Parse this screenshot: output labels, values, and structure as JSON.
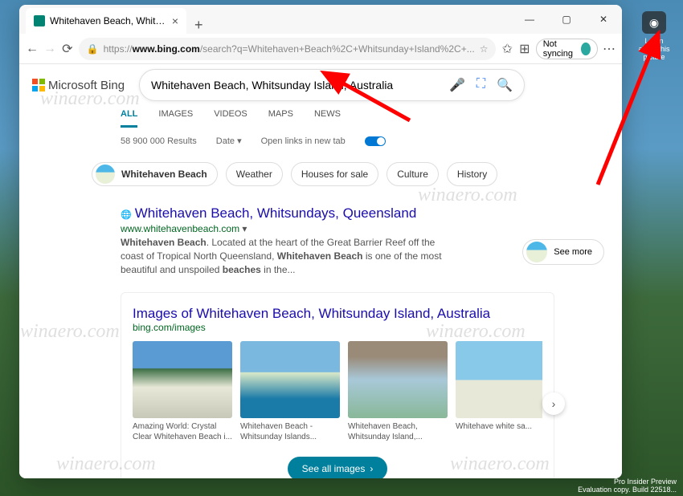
{
  "browser": {
    "tab_title": "Whitehaven Beach, Whitsunday",
    "nav": {
      "url_proto": "https://",
      "url_host": "www.bing.com",
      "url_path": "/search?q=Whitehaven+Beach%2C+Whitsunday+Island%2C+...",
      "sync_label": "Not syncing"
    }
  },
  "desktop_icon": {
    "label": "Learn about this picture"
  },
  "bing": {
    "logo": "Microsoft Bing",
    "search_value": "Whitehaven Beach, Whitsunday Island, Australia",
    "tabs": [
      "ALL",
      "IMAGES",
      "VIDEOS",
      "MAPS",
      "NEWS"
    ],
    "results_count": "58 900 000 Results",
    "date_label": "Date",
    "newtab_label": "Open links in new tab",
    "entity": {
      "name": "Whitehaven Beach",
      "chips": [
        "Weather",
        "Houses for sale",
        "Culture",
        "History"
      ]
    },
    "see_more": "See more",
    "result1": {
      "title": "Whitehaven Beach, Whitsundays, Queensland",
      "url": "www.whitehavenbeach.com",
      "desc_a": "Whitehaven Beach",
      "desc_b": ". Located at the heart of the Great Barrier Reef off the coast of Tropical North Queensland, ",
      "desc_c": "Whitehaven Beach",
      "desc_d": " is one of the most beautiful and unspoiled ",
      "desc_e": "beaches",
      "desc_f": " in the..."
    },
    "images": {
      "heading": "Images of Whitehaven Beach, Whitsunday Island, Australia",
      "sub": "bing.com/images",
      "cards": [
        "Amazing World: Crystal Clear Whitehaven Beach i...",
        "Whitehaven Beach - Whitsunday Islands...",
        "Whitehaven Beach, Whitsunday Island,...",
        "Whitehave white sa..."
      ],
      "see_all": "See all images"
    }
  },
  "taskbar": {
    "line1": "Pro Insider Preview",
    "line2": "Evaluation copy. Build 22518..."
  }
}
